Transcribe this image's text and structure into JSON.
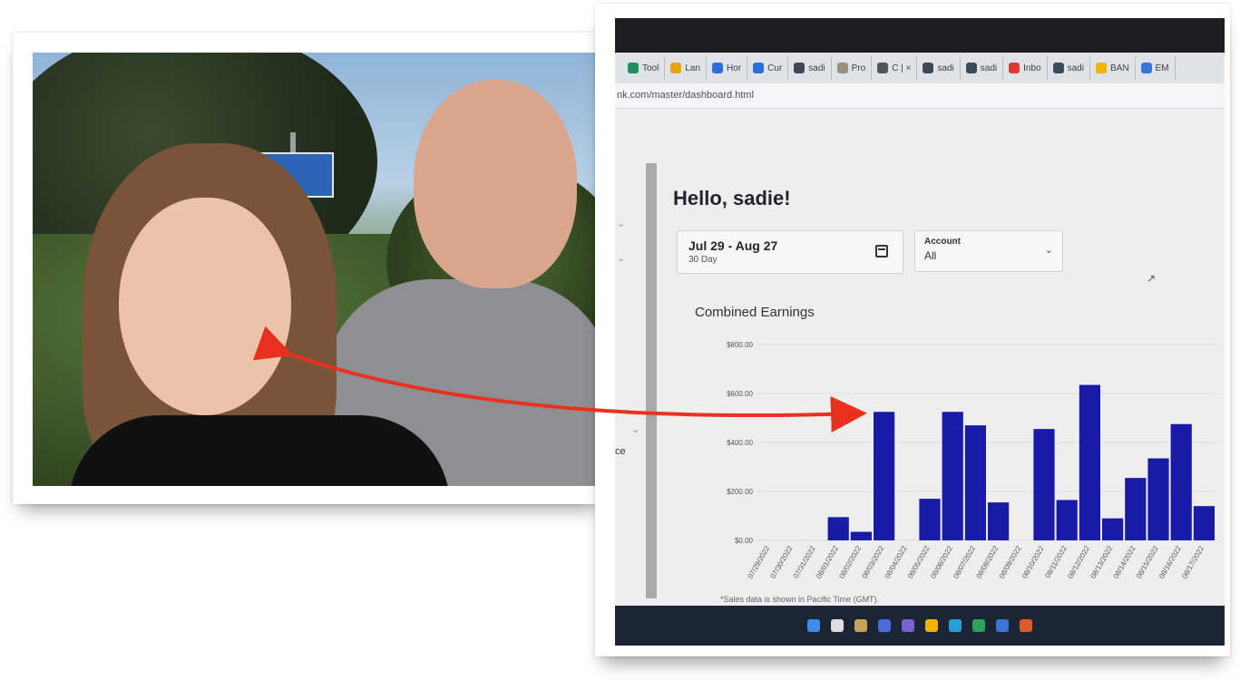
{
  "browser": {
    "tabs": [
      {
        "label": "Tool",
        "color": "#1e8f5c"
      },
      {
        "label": "Lan",
        "color": "#e6a313"
      },
      {
        "label": "Hor",
        "color": "#2c6fdc"
      },
      {
        "label": "Cur",
        "color": "#2c6fdc"
      },
      {
        "label": "sadi",
        "color": "#3c4956"
      },
      {
        "label": "Pro",
        "color": "#9a8f7a"
      },
      {
        "label": "C | ×",
        "color": "#555555"
      },
      {
        "label": "sadi",
        "color": "#3c4956"
      },
      {
        "label": "sadi",
        "color": "#3c4956"
      },
      {
        "label": "Inbo",
        "color": "#d93b30"
      },
      {
        "label": "sadi",
        "color": "#3c4956"
      },
      {
        "label": "BAN",
        "color": "#f2b400"
      },
      {
        "label": "EM",
        "color": "#3b73d9"
      }
    ],
    "address": "nk.com/master/dashboard.html"
  },
  "dashboard": {
    "greeting": "Hello, sadie!",
    "date_range": "Jul 29 - Aug 27",
    "date_sub": "30 Day",
    "account_label": "Account",
    "account_value": "All",
    "side_text": "ce",
    "chart_title": "Combined Earnings",
    "footnote": "*Sales data is shown in Pacific Time (GMT)."
  },
  "chart_data": {
    "type": "bar",
    "title": "Combined Earnings",
    "xlabel": "",
    "ylabel": "",
    "ylim": [
      0,
      800
    ],
    "y_ticks": [
      "$0.00",
      "$200.00",
      "$400.00",
      "$600.00",
      "$800.00"
    ],
    "y_tick_values": [
      0,
      200,
      400,
      600,
      800
    ],
    "color": "#1a1aa8",
    "categories": [
      "07/29/2022",
      "07/30/2022",
      "07/31/2022",
      "08/01/2022",
      "08/02/2022",
      "08/03/2022",
      "08/04/2022",
      "08/05/2022",
      "08/06/2022",
      "08/07/2022",
      "08/08/2022",
      "08/09/2022",
      "08/10/2022",
      "08/11/2022",
      "08/12/2022",
      "08/13/2022",
      "08/14/2022",
      "08/15/2022",
      "08/16/2022",
      "08/17/2022"
    ],
    "values": [
      0,
      0,
      0,
      95,
      35,
      525,
      0,
      170,
      525,
      470,
      155,
      0,
      455,
      165,
      635,
      90,
      255,
      335,
      475,
      140
    ]
  },
  "taskbar": {
    "icons": [
      "#3b8fe8",
      "#dddddd",
      "#c9a35a",
      "#4e6dd8",
      "#7b61d9",
      "#f2b400",
      "#27a0d8",
      "#2fa35a",
      "#3b73d9",
      "#e05a2a"
    ]
  }
}
